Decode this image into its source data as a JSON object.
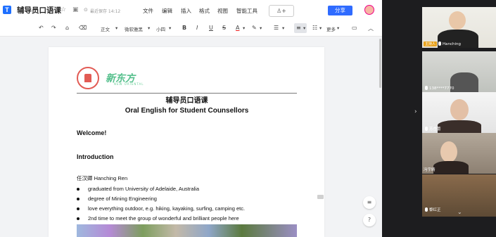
{
  "doc_title": "辅导员口语课",
  "save_status": "最近保存 14:12",
  "menu": [
    "文件",
    "编辑",
    "插入",
    "格式",
    "视图",
    "智能工具"
  ],
  "collab_label": "+",
  "share_label": "分享",
  "toolbar": {
    "style": "正文",
    "font": "微软雅黑",
    "size": "小四",
    "bold": "B",
    "italic": "I",
    "underline": "U",
    "strike": "S",
    "font_color": "A",
    "more": "更多"
  },
  "logo": {
    "text": "新东方",
    "sub": "NEW ORIENTAL"
  },
  "document": {
    "title_cn": "辅导员口语课",
    "title_en": "Oral English for Student Counsellors",
    "welcome": "Welcome!",
    "intro": "Introduction",
    "name_line": "任汉卿 Hanching Ren",
    "bullets": [
      "graduated from University of Adelaide, Australia",
      "degree of Mining Engineering",
      "love everything outdoor, e.g. hiking, kayaking, surfing, camping etc.",
      "2nd time to meet the group of wonderful and brilliant people here"
    ]
  },
  "side_buttons": {
    "help": "?"
  },
  "meeting": {
    "participants": [
      {
        "name": "Hanching",
        "host_badge": "主持人"
      },
      {
        "name": "138****7770"
      },
      {
        "name": "苏杏蕾"
      },
      {
        "name": "冯宇晴"
      },
      {
        "name": "黎红正"
      }
    ]
  },
  "colors": {
    "accent": "#2f6bff",
    "logo_green": "#56c08d",
    "logo_red": "#e25b54"
  },
  "icons": [
    "app-logo-icon",
    "star-icon",
    "folder-icon",
    "check-circle-icon",
    "undo-icon",
    "redo-icon",
    "format-painter-icon",
    "clear-format-icon",
    "highlight-icon",
    "align-icon",
    "list-icon",
    "ordered-list-icon",
    "comment-icon",
    "collapse-icon",
    "mic-icon",
    "chevron-down-icon"
  ]
}
